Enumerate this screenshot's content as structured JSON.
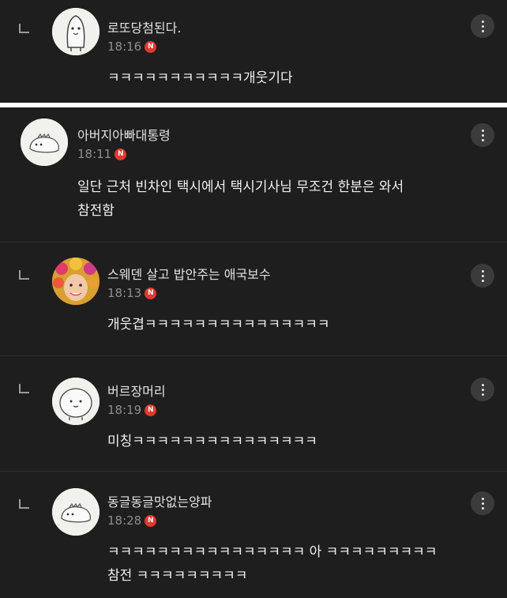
{
  "comments_top": [
    {
      "author": "로또당첨된다.",
      "time": "18:16",
      "badge": "N",
      "lines": [
        "ㅋㅋㅋㅋㅋㅋㅋㅋㅋㅋㅋ개웃기다"
      ]
    }
  ],
  "comments_bottom": [
    {
      "author": "아버지아빠대통령",
      "time": "18:11",
      "badge": "N",
      "lines": [
        "일단 근처 빈차인 택시에서 택시기사님 무조건 한분은 와서",
        "참전함"
      ]
    },
    {
      "author": "스웨덴 살고 밥안주는 애국보수",
      "time": "18:13",
      "badge": "N",
      "lines": [
        "개웃겹ㅋㅋㅋㅋㅋㅋㅋㅋㅋㅋㅋㅋㅋㅋㅋ"
      ]
    },
    {
      "author": "버르장머리",
      "time": "18:19",
      "badge": "N",
      "lines": [
        "미칭ㅋㅋㅋㅋㅋㅋㅋㅋㅋㅋㅋㅋㅋㅋㅋ"
      ]
    },
    {
      "author": "동글동글맛없는양파",
      "time": "18:28",
      "badge": "N",
      "lines": [
        "ㅋㅋㅋㅋㅋㅋㅋㅋㅋㅋㅋㅋㅋㅋㅋㅋ 아 ㅋㅋㅋㅋㅋㅋㅋㅋㅋ",
        "참전 ㅋㅋㅋㅋㅋㅋㅋㅋㅋ"
      ]
    }
  ],
  "colors": {
    "background": "#1e1e1e",
    "separator": "#ffffff",
    "badge": "#e3382c",
    "meta_text": "#8e8e8e"
  },
  "icons": {
    "reply": "reply-arrow-icon",
    "menu": "more-vertical-icon",
    "badge": "new-badge"
  }
}
